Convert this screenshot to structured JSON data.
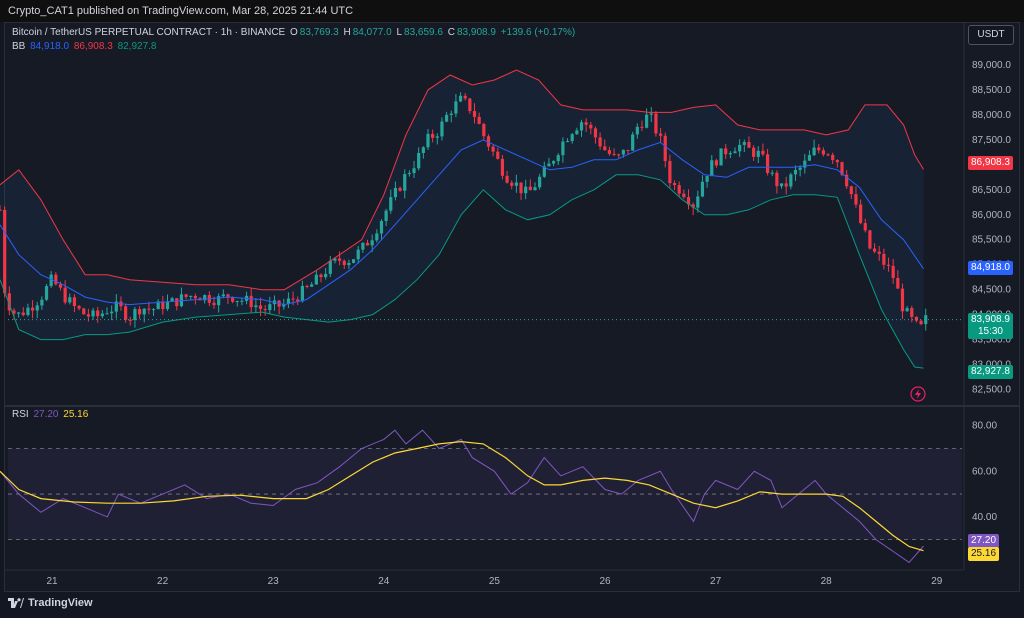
{
  "header": {
    "publish_line": "Crypto_CAT1 published on TradingView.com, Mar 28, 2025 21:44 UTC"
  },
  "legend": {
    "symbol": "Bitcoin / TetherUS PERPETUAL CONTRACT · 1h · BINANCE",
    "o_label": "O",
    "o_value": "83,769.3",
    "h_label": "H",
    "h_value": "84,077.0",
    "l_label": "L",
    "l_value": "83,659.6",
    "c_label": "C",
    "c_value": "83,908.9",
    "change": "+139.6 (+0.17%)",
    "bb_label": "BB",
    "bb_basis": "84,918.0",
    "bb_upper": "86,908.3",
    "bb_lower": "82,927.8",
    "rsi_label": "RSI",
    "rsi_value": "27.20",
    "rsi_ma": "25.16"
  },
  "currency": "USDT",
  "footer": {
    "brand": "TradingView"
  },
  "tags": {
    "upper": "86,908.3",
    "basis": "84,918.0",
    "price": "83,908.9",
    "countdown": "15:30",
    "lower": "82,927.8",
    "rsi": "27.20",
    "rsi_ma": "25.16"
  },
  "colors": {
    "up": "#26a69a",
    "down": "#f23645",
    "basis": "#2962ff",
    "upper": "#f23645",
    "lower": "#089981",
    "rsi": "#7e57c2",
    "rsi_ma": "#fdd835",
    "background": "#131722"
  },
  "chart_data": {
    "type": "candlestick",
    "price_axis": {
      "ticks": [
        82500,
        83000,
        83500,
        84000,
        84500,
        85000,
        85500,
        86000,
        86500,
        87000,
        87500,
        88000,
        88500,
        89000
      ],
      "tick_labels": [
        "82,500.0",
        "83,000.0",
        "83,500.0",
        "84,000.0",
        "84,500.0",
        "85,000.0",
        "85,500.0",
        "86,000.0",
        "86,500.0",
        "87,000.0",
        "87,500.0",
        "88,000.0",
        "88,500.0",
        "89,000.0"
      ],
      "range": [
        82250,
        89300
      ]
    },
    "time_axis": {
      "ticks": [
        21,
        22,
        23,
        24,
        25,
        26,
        27,
        28,
        29
      ],
      "tick_labels": [
        "21",
        "22",
        "23",
        "24",
        "25",
        "26",
        "27",
        "28",
        "29"
      ]
    },
    "close_path": [
      [
        20.53,
        86100
      ],
      [
        20.56,
        84600
      ],
      [
        20.6,
        84250
      ],
      [
        20.65,
        84050
      ],
      [
        20.7,
        84000
      ],
      [
        20.8,
        84150
      ],
      [
        20.9,
        84350
      ],
      [
        21.0,
        84700
      ],
      [
        21.1,
        84400
      ],
      [
        21.2,
        84150
      ],
      [
        21.3,
        84000
      ],
      [
        21.4,
        83950
      ],
      [
        21.5,
        84100
      ],
      [
        21.6,
        84150
      ],
      [
        21.7,
        83950
      ],
      [
        21.8,
        84150
      ],
      [
        21.9,
        84100
      ],
      [
        22.0,
        84200
      ],
      [
        22.1,
        84250
      ],
      [
        22.2,
        84350
      ],
      [
        22.3,
        84400
      ],
      [
        22.4,
        84350
      ],
      [
        22.5,
        84300
      ],
      [
        22.6,
        84400
      ],
      [
        22.7,
        84300
      ],
      [
        22.8,
        84250
      ],
      [
        22.9,
        84100
      ],
      [
        23.0,
        84150
      ],
      [
        23.1,
        84200
      ],
      [
        23.2,
        84350
      ],
      [
        23.3,
        84500
      ],
      [
        23.4,
        84700
      ],
      [
        23.5,
        84950
      ],
      [
        23.6,
        85100
      ],
      [
        23.7,
        85100
      ],
      [
        23.8,
        85300
      ],
      [
        23.9,
        85600
      ],
      [
        24.0,
        86000
      ],
      [
        24.1,
        86400
      ],
      [
        24.2,
        86800
      ],
      [
        24.3,
        87100
      ],
      [
        24.4,
        87500
      ],
      [
        24.5,
        87700
      ],
      [
        24.6,
        88100
      ],
      [
        24.7,
        88300
      ],
      [
        24.8,
        88100
      ],
      [
        24.9,
        87600
      ],
      [
        25.0,
        87200
      ],
      [
        25.1,
        86800
      ],
      [
        25.2,
        86600
      ],
      [
        25.3,
        86400
      ],
      [
        25.4,
        86700
      ],
      [
        25.5,
        87000
      ],
      [
        25.6,
        87400
      ],
      [
        25.7,
        87700
      ],
      [
        25.8,
        87900
      ],
      [
        25.9,
        87600
      ],
      [
        26.0,
        87300
      ],
      [
        26.1,
        87100
      ],
      [
        26.2,
        87300
      ],
      [
        26.3,
        87800
      ],
      [
        26.4,
        88000
      ],
      [
        26.5,
        87500
      ],
      [
        26.6,
        86600
      ],
      [
        26.7,
        86500
      ],
      [
        26.8,
        86200
      ],
      [
        26.9,
        86800
      ],
      [
        27.0,
        87100
      ],
      [
        27.1,
        87300
      ],
      [
        27.2,
        87400
      ],
      [
        27.3,
        87300
      ],
      [
        27.4,
        87200
      ],
      [
        27.5,
        86800
      ],
      [
        27.6,
        86500
      ],
      [
        27.7,
        86800
      ],
      [
        27.8,
        87000
      ],
      [
        27.9,
        87300
      ],
      [
        28.0,
        87300
      ],
      [
        28.1,
        87100
      ],
      [
        28.2,
        86600
      ],
      [
        28.3,
        85900
      ],
      [
        28.4,
        85300
      ],
      [
        28.5,
        85100
      ],
      [
        28.6,
        84800
      ],
      [
        28.7,
        84100
      ],
      [
        28.8,
        83800
      ],
      [
        28.85,
        83700
      ],
      [
        28.9,
        83900
      ]
    ],
    "bb_upper": [
      [
        20.53,
        86600
      ],
      [
        20.7,
        86900
      ],
      [
        20.9,
        86300
      ],
      [
        21.1,
        85500
      ],
      [
        21.3,
        84800
      ],
      [
        21.5,
        84800
      ],
      [
        21.7,
        84700
      ],
      [
        22.0,
        84650
      ],
      [
        22.3,
        84600
      ],
      [
        22.6,
        84600
      ],
      [
        22.9,
        84500
      ],
      [
        23.1,
        84500
      ],
      [
        23.4,
        84900
      ],
      [
        23.6,
        85200
      ],
      [
        23.8,
        85500
      ],
      [
        24.0,
        86400
      ],
      [
        24.2,
        87600
      ],
      [
        24.4,
        88500
      ],
      [
        24.6,
        88800
      ],
      [
        24.8,
        88600
      ],
      [
        25.0,
        88700
      ],
      [
        25.2,
        88900
      ],
      [
        25.4,
        88700
      ],
      [
        25.6,
        88200
      ],
      [
        25.8,
        88100
      ],
      [
        26.0,
        88100
      ],
      [
        26.2,
        88100
      ],
      [
        26.4,
        88050
      ],
      [
        26.6,
        88050
      ],
      [
        26.8,
        88150
      ],
      [
        27.0,
        88200
      ],
      [
        27.2,
        87800
      ],
      [
        27.4,
        87700
      ],
      [
        27.6,
        87700
      ],
      [
        27.8,
        87700
      ],
      [
        28.0,
        87600
      ],
      [
        28.2,
        87700
      ],
      [
        28.35,
        88200
      ],
      [
        28.55,
        88200
      ],
      [
        28.7,
        87800
      ],
      [
        28.8,
        87200
      ],
      [
        28.88,
        86908
      ]
    ],
    "bb_basis": [
      [
        20.53,
        85800
      ],
      [
        20.7,
        85200
      ],
      [
        20.9,
        84800
      ],
      [
        21.1,
        84600
      ],
      [
        21.3,
        84350
      ],
      [
        21.5,
        84250
      ],
      [
        21.7,
        84200
      ],
      [
        22.0,
        84250
      ],
      [
        22.3,
        84300
      ],
      [
        22.6,
        84350
      ],
      [
        22.9,
        84300
      ],
      [
        23.1,
        84200
      ],
      [
        23.3,
        84300
      ],
      [
        23.5,
        84600
      ],
      [
        23.7,
        84900
      ],
      [
        23.9,
        85300
      ],
      [
        24.1,
        85800
      ],
      [
        24.3,
        86300
      ],
      [
        24.5,
        86800
      ],
      [
        24.7,
        87300
      ],
      [
        24.9,
        87500
      ],
      [
        25.1,
        87300
      ],
      [
        25.3,
        87100
      ],
      [
        25.5,
        86900
      ],
      [
        25.7,
        86950
      ],
      [
        25.9,
        87100
      ],
      [
        26.1,
        87100
      ],
      [
        26.3,
        87300
      ],
      [
        26.5,
        87450
      ],
      [
        26.7,
        87100
      ],
      [
        26.9,
        86800
      ],
      [
        27.1,
        86750
      ],
      [
        27.3,
        86950
      ],
      [
        27.5,
        86950
      ],
      [
        27.7,
        86950
      ],
      [
        27.9,
        87000
      ],
      [
        28.1,
        86900
      ],
      [
        28.3,
        86550
      ],
      [
        28.5,
        85900
      ],
      [
        28.7,
        85500
      ],
      [
        28.88,
        84918
      ]
    ],
    "bb_lower": [
      [
        20.53,
        84700
      ],
      [
        20.7,
        83700
      ],
      [
        20.9,
        83500
      ],
      [
        21.1,
        83500
      ],
      [
        21.3,
        83600
      ],
      [
        21.5,
        83600
      ],
      [
        21.7,
        83650
      ],
      [
        22.0,
        83850
      ],
      [
        22.3,
        83950
      ],
      [
        22.6,
        84000
      ],
      [
        22.9,
        84050
      ],
      [
        23.1,
        83950
      ],
      [
        23.3,
        83900
      ],
      [
        23.5,
        83850
      ],
      [
        23.7,
        83900
      ],
      [
        23.9,
        84000
      ],
      [
        24.1,
        84300
      ],
      [
        24.3,
        84700
      ],
      [
        24.5,
        85200
      ],
      [
        24.7,
        86000
      ],
      [
        24.9,
        86500
      ],
      [
        25.1,
        86100
      ],
      [
        25.3,
        85900
      ],
      [
        25.5,
        86000
      ],
      [
        25.7,
        86300
      ],
      [
        25.9,
        86500
      ],
      [
        26.1,
        86800
      ],
      [
        26.3,
        86800
      ],
      [
        26.5,
        86700
      ],
      [
        26.7,
        86300
      ],
      [
        26.9,
        86000
      ],
      [
        27.1,
        86000
      ],
      [
        27.3,
        86100
      ],
      [
        27.5,
        86300
      ],
      [
        27.7,
        86400
      ],
      [
        27.9,
        86400
      ],
      [
        28.1,
        86350
      ],
      [
        28.3,
        85200
      ],
      [
        28.5,
        84100
      ],
      [
        28.7,
        83300
      ],
      [
        28.8,
        82950
      ],
      [
        28.88,
        82928
      ]
    ],
    "rsi": {
      "ticks": [
        40,
        60,
        80
      ],
      "tick_labels": [
        "40.00",
        "60.00",
        "80.00"
      ],
      "bands": [
        30,
        50,
        70
      ],
      "range": [
        18,
        86
      ],
      "rsi_line": [
        [
          20.53,
          60
        ],
        [
          20.7,
          50
        ],
        [
          20.9,
          42
        ],
        [
          21.1,
          48
        ],
        [
          21.3,
          44
        ],
        [
          21.5,
          40
        ],
        [
          21.6,
          50
        ],
        [
          21.8,
          46
        ],
        [
          22.0,
          50
        ],
        [
          22.2,
          54
        ],
        [
          22.4,
          48
        ],
        [
          22.6,
          50
        ],
        [
          22.8,
          46
        ],
        [
          23.0,
          45
        ],
        [
          23.2,
          52
        ],
        [
          23.4,
          55
        ],
        [
          23.6,
          62
        ],
        [
          23.8,
          70
        ],
        [
          24.0,
          74
        ],
        [
          24.1,
          78
        ],
        [
          24.2,
          72
        ],
        [
          24.35,
          78
        ],
        [
          24.5,
          70
        ],
        [
          24.7,
          74
        ],
        [
          24.8,
          66
        ],
        [
          25.0,
          60
        ],
        [
          25.15,
          50
        ],
        [
          25.3,
          55
        ],
        [
          25.45,
          66
        ],
        [
          25.6,
          58
        ],
        [
          25.8,
          62
        ],
        [
          26.0,
          52
        ],
        [
          26.15,
          50
        ],
        [
          26.3,
          56
        ],
        [
          26.5,
          60
        ],
        [
          26.6,
          52
        ],
        [
          26.7,
          45
        ],
        [
          26.8,
          38
        ],
        [
          26.9,
          50
        ],
        [
          27.0,
          56
        ],
        [
          27.2,
          52
        ],
        [
          27.35,
          60
        ],
        [
          27.5,
          56
        ],
        [
          27.6,
          44
        ],
        [
          27.8,
          52
        ],
        [
          27.9,
          56
        ],
        [
          28.0,
          50
        ],
        [
          28.15,
          44
        ],
        [
          28.3,
          38
        ],
        [
          28.45,
          30
        ],
        [
          28.6,
          25
        ],
        [
          28.75,
          20
        ],
        [
          28.88,
          27.2
        ]
      ],
      "rsi_ma_line": [
        [
          20.53,
          60
        ],
        [
          20.7,
          52
        ],
        [
          20.9,
          48
        ],
        [
          21.2,
          46.5
        ],
        [
          21.5,
          46
        ],
        [
          21.8,
          46
        ],
        [
          22.1,
          47
        ],
        [
          22.4,
          49
        ],
        [
          22.7,
          49.5
        ],
        [
          23.0,
          48
        ],
        [
          23.3,
          48
        ],
        [
          23.5,
          52
        ],
        [
          23.7,
          58
        ],
        [
          23.9,
          64
        ],
        [
          24.1,
          68
        ],
        [
          24.3,
          70
        ],
        [
          24.5,
          72
        ],
        [
          24.7,
          73
        ],
        [
          24.9,
          72
        ],
        [
          25.1,
          66
        ],
        [
          25.3,
          58
        ],
        [
          25.45,
          54
        ],
        [
          25.6,
          54
        ],
        [
          25.8,
          56
        ],
        [
          26.0,
          57
        ],
        [
          26.2,
          56
        ],
        [
          26.4,
          54
        ],
        [
          26.6,
          50
        ],
        [
          26.8,
          46
        ],
        [
          27.0,
          44
        ],
        [
          27.2,
          47
        ],
        [
          27.4,
          51
        ],
        [
          27.6,
          50
        ],
        [
          27.8,
          50
        ],
        [
          28.0,
          50
        ],
        [
          28.15,
          49
        ],
        [
          28.3,
          44
        ],
        [
          28.45,
          38
        ],
        [
          28.6,
          32
        ],
        [
          28.75,
          27
        ],
        [
          28.88,
          25.16
        ]
      ]
    }
  }
}
